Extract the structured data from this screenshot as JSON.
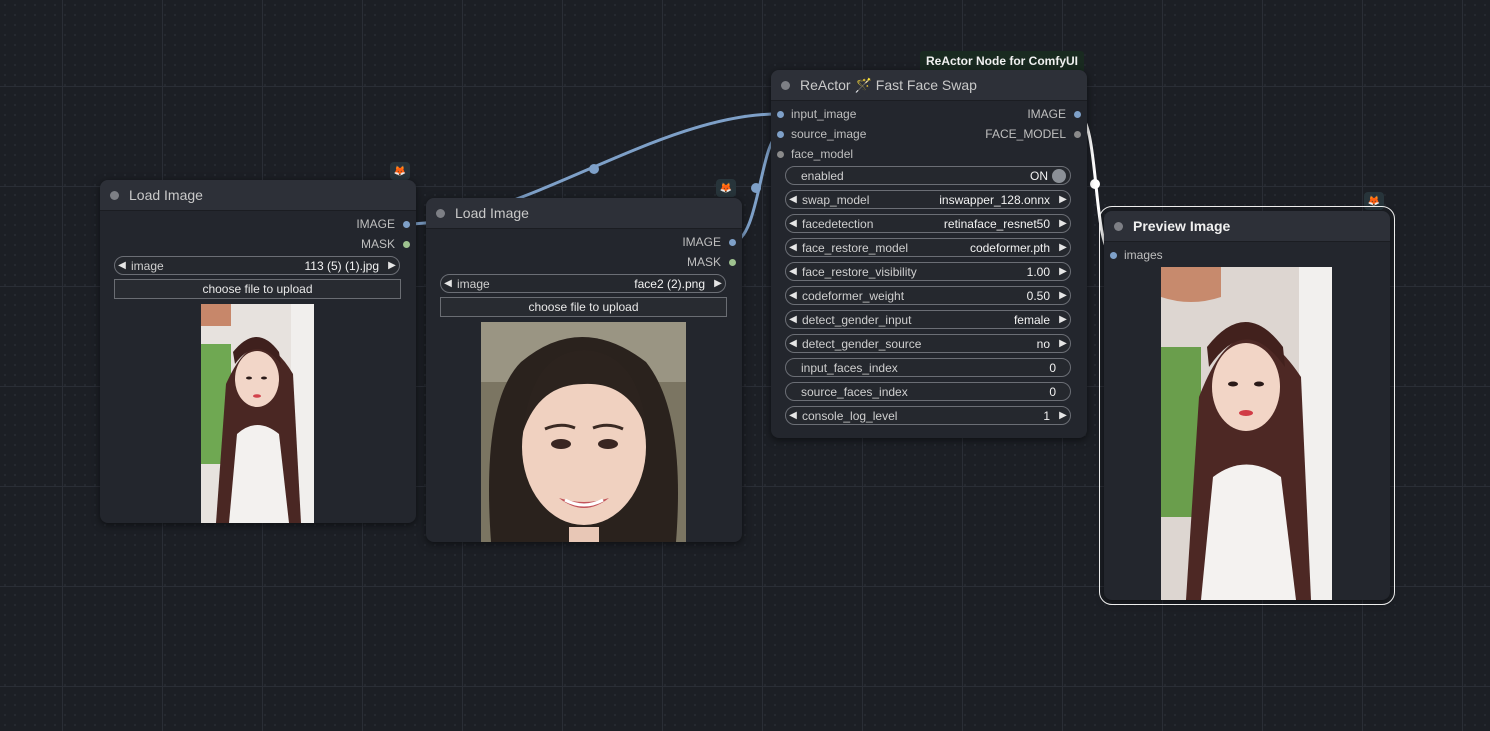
{
  "group_title": "ReActor Node for ComfyUI",
  "nodes": {
    "load1": {
      "title": "Load Image",
      "outputs": [
        "IMAGE",
        "MASK"
      ],
      "image_widget": {
        "label": "image",
        "value": "113 (5) (1).jpg"
      },
      "upload_label": "choose file to upload"
    },
    "load2": {
      "title": "Load Image",
      "outputs": [
        "IMAGE",
        "MASK"
      ],
      "image_widget": {
        "label": "image",
        "value": "face2 (2).png"
      },
      "upload_label": "choose file to upload"
    },
    "reactor": {
      "title": "ReActor 🪄 Fast Face Swap",
      "inputs": [
        "input_image",
        "source_image",
        "face_model"
      ],
      "outputs": [
        "IMAGE",
        "FACE_MODEL"
      ],
      "widgets": [
        {
          "label": "enabled",
          "value": "ON"
        },
        {
          "label": "swap_model",
          "value": "inswapper_128.onnx"
        },
        {
          "label": "facedetection",
          "value": "retinaface_resnet50"
        },
        {
          "label": "face_restore_model",
          "value": "codeformer.pth"
        },
        {
          "label": "face_restore_visibility",
          "value": "1.00"
        },
        {
          "label": "codeformer_weight",
          "value": "0.50"
        },
        {
          "label": "detect_gender_input",
          "value": "female"
        },
        {
          "label": "detect_gender_source",
          "value": "no"
        },
        {
          "label": "input_faces_index",
          "value": "0"
        },
        {
          "label": "source_faces_index",
          "value": "0"
        },
        {
          "label": "console_log_level",
          "value": "1"
        }
      ]
    },
    "preview": {
      "title": "Preview Image",
      "inputs": [
        "images"
      ]
    }
  },
  "icons": {
    "badge": "fox-icon",
    "arrow_left": "triangle-left-icon",
    "arrow_right": "triangle-right-icon"
  },
  "colors": {
    "image_slot": "#7ea0c8",
    "mask_slot": "#9ec28f",
    "face_model_slot": "#8a8a8a",
    "link_image": "#7ea0c8",
    "link_selected": "#ffffff",
    "accent_badge": "#ff7a2a"
  }
}
